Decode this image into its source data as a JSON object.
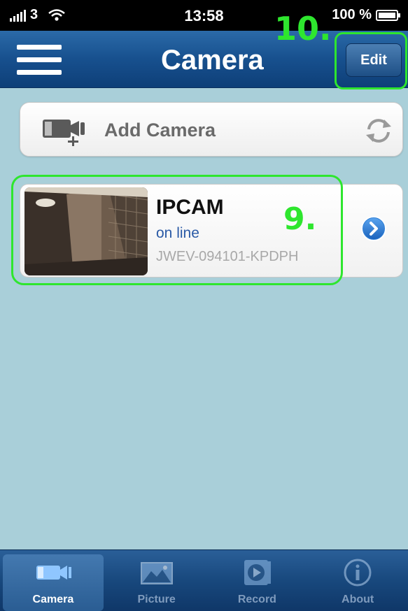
{
  "status_bar": {
    "carrier": "3",
    "time": "13:58",
    "battery": "100 %"
  },
  "nav": {
    "title": "Camera",
    "edit_label": "Edit",
    "annotation_edit": "10."
  },
  "add_camera": {
    "label": "Add Camera",
    "icons": [
      "camera-add-icon",
      "refresh-icon"
    ]
  },
  "cameras": [
    {
      "name": "IPCAM",
      "status": "on line",
      "id": "JWEV-094101-KPDPH",
      "annotation": "9."
    }
  ],
  "tabs": [
    {
      "label": "Camera",
      "icon": "camera-icon",
      "active": true
    },
    {
      "label": "Picture",
      "icon": "picture-icon",
      "active": false
    },
    {
      "label": "Record",
      "icon": "record-icon",
      "active": false
    },
    {
      "label": "About",
      "icon": "info-icon",
      "active": false
    }
  ],
  "colors": {
    "nav_bar": "#17508e",
    "background": "#a9cfd9",
    "annotation": "#2ee62e",
    "status_online": "#2a5aa6"
  }
}
